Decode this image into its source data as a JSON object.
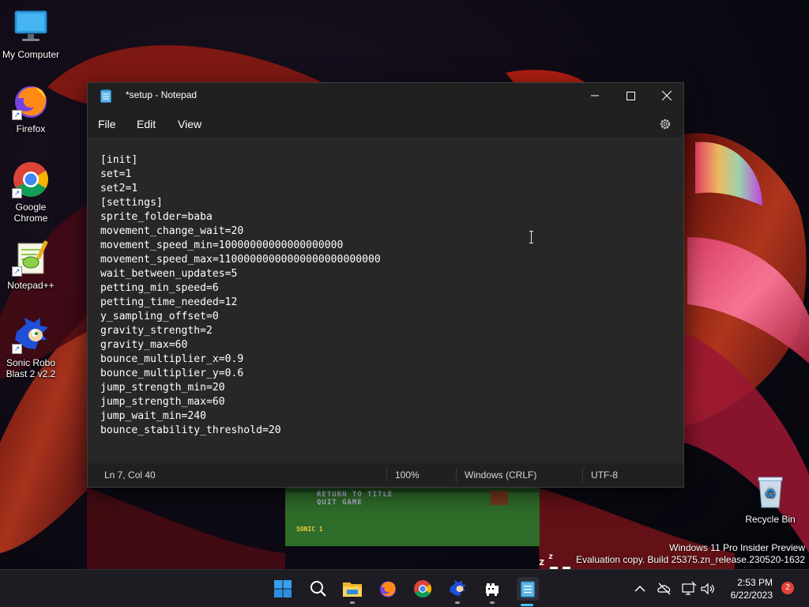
{
  "desktop": {
    "icons": [
      {
        "label": "My Computer",
        "icon": "monitor-icon"
      },
      {
        "label": "Firefox",
        "icon": "firefox-icon"
      },
      {
        "label": "Google Chrome",
        "icon": "chrome-icon"
      },
      {
        "label": "Notepad++",
        "icon": "notepadpp-icon"
      },
      {
        "label": "Sonic Robo Blast 2 v2.2",
        "icon": "sonic-icon"
      },
      {
        "label": "Recycle Bin",
        "icon": "recycle-bin-icon"
      }
    ]
  },
  "notepad": {
    "title": "*setup - Notepad",
    "menu": [
      "File",
      "Edit",
      "View"
    ],
    "lines": [
      "[init]",
      "set=1",
      "set2=1",
      "[settings]",
      "sprite_folder=baba",
      "movement_change_wait=20",
      "movement_speed_min=10000000000000000000",
      "movement_speed_max=11000000000000000000000000",
      "wait_between_updates=5",
      "petting_min_speed=6",
      "petting_time_needed=12",
      "y_sampling_offset=0",
      "gravity_strength=2",
      "gravity_max=60",
      "bounce_multiplier_x=0.9",
      "bounce_multiplier_y=0.6",
      "jump_strength_min=20",
      "jump_strength_max=60",
      "jump_wait_min=240",
      "bounce_stability_threshold=20"
    ],
    "status": {
      "position": "Ln 7, Col 40",
      "zoom": "100%",
      "line_ending": "Windows (CRLF)",
      "encoding": "UTF-8"
    }
  },
  "game": {
    "menu_line1": "RETURN TO TITLE",
    "menu_line2": "QUIT GAME",
    "life_name": "SONIC",
    "life_count": "1"
  },
  "watermark": {
    "line1": "Windows 11 Pro Insider Preview",
    "line2": "Evaluation copy. Build 25375.zn_release.230520-1632"
  },
  "taskbar": {
    "apps": [
      "start-icon",
      "search-icon",
      "file-explorer-icon",
      "firefox-icon",
      "chrome-icon",
      "sonic-icon",
      "pet-app-icon",
      "notepad-icon"
    ],
    "time": "2:53 PM",
    "date": "6/22/2023",
    "notification_count": "2"
  },
  "colors": {
    "accent": "#4cc2ff",
    "window_bg": "#272727",
    "titlebar_bg": "#202020",
    "taskbar_bg": "#1c1c22",
    "badge": "#e0443a"
  }
}
